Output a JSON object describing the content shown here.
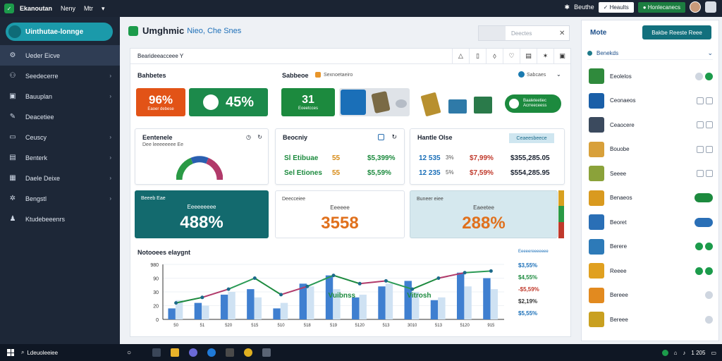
{
  "topbar": {
    "app_title": "Ekanoutan",
    "menu_1": "Neny",
    "menu_2": "Mtr",
    "menu_chevron": "▾",
    "gear_label": "Beuthe",
    "white_button": "Heaults",
    "green_button": "Honlecanecs"
  },
  "sidebar": {
    "brand": "Uinthutae-lonnge",
    "items": [
      {
        "label": "Ueder Eicve",
        "icon": "gear-icon"
      },
      {
        "label": "Seedecerre",
        "icon": "network-icon"
      },
      {
        "label": "Bauuplan",
        "icon": "document-icon"
      },
      {
        "label": "Deacetiee",
        "icon": "edit-icon"
      },
      {
        "label": "Ceuscy",
        "icon": "folder-icon"
      },
      {
        "label": "Benterk",
        "icon": "clipboard-icon"
      },
      {
        "label": "Daele Deixe",
        "icon": "grid-icon"
      },
      {
        "label": "Bengstl",
        "icon": "gears-icon"
      },
      {
        "label": "Ktudebeeenrs",
        "icon": "users-icon"
      }
    ]
  },
  "main": {
    "title": "Umghmic",
    "subtitle": "Nieo, Che Snes",
    "search_placeholder": "Deectes",
    "toolbar_label": "Bearideeacceee Y",
    "section1": "Bahbetes",
    "section2": "Sabbeoe",
    "section2_tag": "Sexnoetaeiro",
    "section2_right": "Sabcaes",
    "tiles": [
      {
        "value": "96%",
        "sub": "Eaoer debese",
        "color": "#e25317"
      },
      {
        "value": "45%",
        "sub": "",
        "color": "#1c8a4b"
      },
      {
        "value": "31",
        "sub": "Eoeetcces",
        "color": "#1c8a3e"
      }
    ],
    "tile_action": "Baaleteetiec Acrreeceess",
    "card_left": {
      "title": "Eentenele",
      "sub": "Dee leeeeeeee Ee"
    },
    "card_mid": {
      "title": "Beocniy",
      "rows": [
        {
          "name": "Sl Etibuae",
          "n": "55",
          "pct": "$5,399%"
        },
        {
          "name": "Sel Etiones",
          "n": "55",
          "pct": "$5,59%"
        }
      ]
    },
    "card_right": {
      "title": "Hantle Olse",
      "tag": "Ceaeesbeece",
      "rows": [
        {
          "a": "12 535",
          "b": "3%",
          "c": "$7,99%",
          "d": "$355,285.05"
        },
        {
          "a": "12 235",
          "b": "5%",
          "c": "$7,59%",
          "d": "$554,285.95"
        }
      ]
    },
    "stats": [
      {
        "head": "Beeeb Eae",
        "sub": "Eeeeeeeee",
        "value": "488%"
      },
      {
        "head": "Deecceiee",
        "sub": "Eeeeee",
        "value": "3558"
      },
      {
        "head": "Buneer eiee",
        "sub": "Eaeetee",
        "value": "288%"
      }
    ],
    "chart_title": "Notooees elaygnt",
    "chart_link": "Eeeeereeeeeee"
  },
  "chart_data": {
    "type": "bar",
    "title": "Notooees elaygnt",
    "yticks": [
      "980",
      "90",
      "30",
      "20",
      "0"
    ],
    "categories": [
      "50",
      "51",
      "520",
      "515",
      "510",
      "518",
      "519",
      "5120",
      "513",
      "3010",
      "513",
      "5120",
      "915"
    ],
    "series": [
      {
        "values": [
          20,
          30,
          45,
          55,
          20,
          65,
          80,
          40,
          60,
          70,
          35,
          85,
          75
        ]
      },
      {
        "values": [
          35,
          25,
          50,
          40,
          30,
          60,
          55,
          45,
          65,
          50,
          40,
          60,
          55
        ]
      }
    ],
    "line": [
      30,
      40,
      55,
      75,
      45,
      60,
      80,
      65,
      70,
      55,
      75,
      85,
      88
    ],
    "annotations": [
      "Vuibnss",
      "Vitrosh"
    ],
    "right_values": [
      "$3,55%",
      "$4,55%",
      "-$5,59%",
      "$2,19%",
      "$5,55%"
    ],
    "ylim": [
      0,
      100
    ]
  },
  "rpanel": {
    "title": "Mote",
    "button": "Bakbe Reeste Reee",
    "group": "Benekds",
    "items": [
      {
        "label": "Eeolelos",
        "icon": "money-icon",
        "color": "#2f8a3c",
        "ctl": "toggle-dots"
      },
      {
        "label": "Ceonaeos",
        "icon": "monitor-icon",
        "color": "#1a5fa8",
        "ctl": "checkbox"
      },
      {
        "label": "Ceaocere",
        "icon": "calendar-icon",
        "color": "#3b4a5e",
        "ctl": "checkbox"
      },
      {
        "label": "Bouobe",
        "icon": "box-icon",
        "color": "#d8a03a",
        "ctl": "checkbox"
      },
      {
        "label": "Seeee",
        "icon": "cash-icon",
        "color": "#8ba23a",
        "ctl": "checkbox"
      },
      {
        "label": "Benaeos",
        "icon": "coin-icon",
        "color": "#d99a1f",
        "ctl": "toggle-green"
      },
      {
        "label": "Beoret",
        "icon": "calculator-icon",
        "color": "#2a6fb6",
        "ctl": "toggle-blue"
      },
      {
        "label": "Berere",
        "icon": "book-icon",
        "color": "#2d7ab8",
        "ctl": "dots"
      },
      {
        "label": "Reeee",
        "icon": "card-icon",
        "color": "#e0a020",
        "ctl": "dots"
      },
      {
        "label": "Bereee",
        "icon": "wallet-icon",
        "color": "#e28a1f",
        "ctl": "dot"
      },
      {
        "label": "Bereee",
        "icon": "coin-icon",
        "color": "#c9a020",
        "ctl": "dot"
      }
    ]
  },
  "taskbar": {
    "search": "Ldeuoleeiee",
    "time": "1 205"
  }
}
